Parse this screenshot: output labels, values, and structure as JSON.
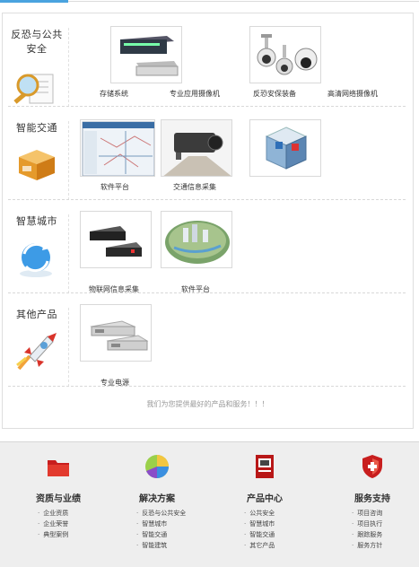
{
  "sections": [
    {
      "title": "反恐与公共安全",
      "products": [
        {
          "caption": "存储系统"
        },
        {
          "caption": "专业应用摄像机"
        },
        {
          "caption": "反恐安保装备"
        },
        {
          "caption": "高清网络摄像机"
        }
      ]
    },
    {
      "title": "智能交通",
      "products": [
        {
          "caption": "软件平台"
        },
        {
          "caption": "交通信息采集"
        },
        {
          "caption": ""
        }
      ]
    },
    {
      "title": "智慧城市",
      "products": [
        {
          "caption": "物联网信息采集"
        },
        {
          "caption": "软件平台"
        }
      ]
    },
    {
      "title": "其他产品",
      "products": [
        {
          "caption": "专业电源"
        }
      ]
    }
  ],
  "slogan": "我们为您提供最好的产品和服务！！！",
  "footer": [
    {
      "heading": "资质与业绩",
      "icon": "folder-icon",
      "items": [
        "企业资质",
        "企业荣誉",
        "典型案例"
      ]
    },
    {
      "heading": "解决方案",
      "icon": "pie-chart-icon",
      "items": [
        "反恐与公共安全",
        "智慧城市",
        "智能交通",
        "智能建筑"
      ]
    },
    {
      "heading": "产品中心",
      "icon": "product-book-icon",
      "items": [
        "公共安全",
        "智慧城市",
        "智能交通",
        "其它产品"
      ]
    },
    {
      "heading": "服务支持",
      "icon": "shield-icon",
      "items": [
        "项目咨询",
        "项目执行",
        "跟踪服务",
        "服务方针"
      ]
    }
  ],
  "colors": {
    "accent": "#4aa3df",
    "footer_bg": "#eeeeee"
  }
}
